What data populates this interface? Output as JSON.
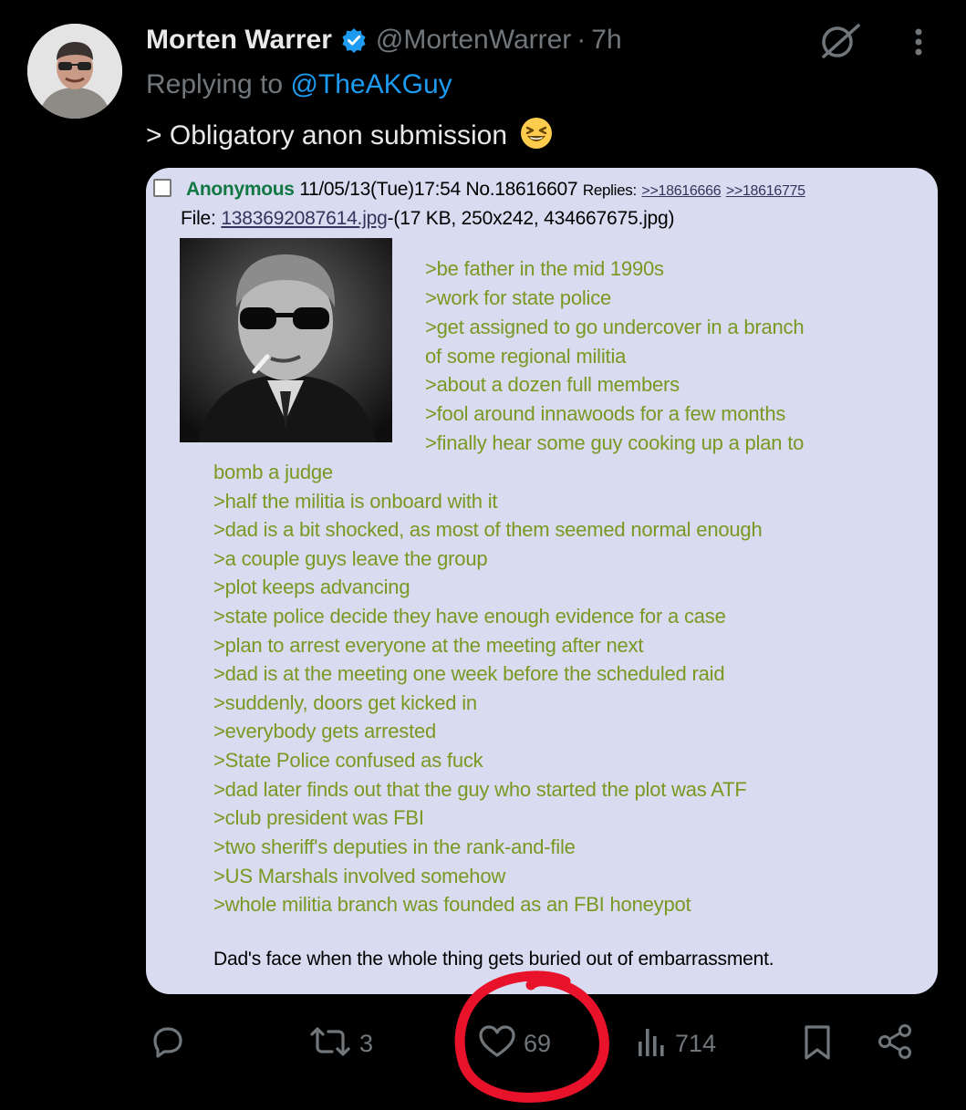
{
  "tweet": {
    "author": {
      "display_name": "Morten Warrer",
      "handle": "@MortenWarrer",
      "verified": true
    },
    "separator": "·",
    "time": "7h",
    "reply_prefix": "Replying to",
    "reply_to": "@TheAKGuy",
    "text": "> Obligatory anon submission",
    "emoji": "grinning-squinting-face"
  },
  "post": {
    "name": "Anonymous",
    "datetime": "11/05/13(Tue)17:54",
    "number": "No.18616607",
    "replies_label": "Replies:",
    "replies": [
      ">>18616666",
      ">>18616775"
    ],
    "file_label": "File:",
    "file_name": "1383692087614.jpg",
    "file_info": "-(17 KB, 250x242, 434667675.jpg)",
    "image_description": "thumbnail-photo",
    "lines": [
      ">be father in the mid 1990s",
      ">work for state police",
      ">get assigned to go undercover in a branch",
      "of some regional militia",
      ">about a dozen full members",
      ">fool around innawoods for a few months",
      ">finally hear some guy cooking up a plan to",
      "bomb a judge",
      ">half the militia is onboard with it",
      ">dad is a bit shocked, as most of them seemed normal enough",
      ">a couple guys leave the group",
      ">plot keeps advancing",
      ">state police decide they have enough evidence for a case",
      ">plan to arrest everyone at the meeting after next",
      ">dad is at the meeting one week before the scheduled raid",
      ">suddenly, doors get kicked in",
      ">everybody gets arrested",
      ">State Police confused as fuck",
      ">dad later finds out that the guy who started the plot was ATF",
      ">club president was FBI",
      ">two sheriff's deputies in the rank-and-file",
      ">US Marshals involved somehow",
      ">whole militia branch was founded as an FBI honeypot"
    ],
    "footer": "Dad's face when the whole thing gets buried out of embarrassment."
  },
  "actions": {
    "reply": "",
    "repost": "3",
    "like": "69",
    "views": "714"
  },
  "colors": {
    "background": "#000000",
    "text": "#e7e9ea",
    "muted": "#71767b",
    "link": "#1d9bf0",
    "card": "#d9dbf0",
    "greentext": "#789922",
    "anon_name": "#117743",
    "annotation": "#e8132a"
  }
}
